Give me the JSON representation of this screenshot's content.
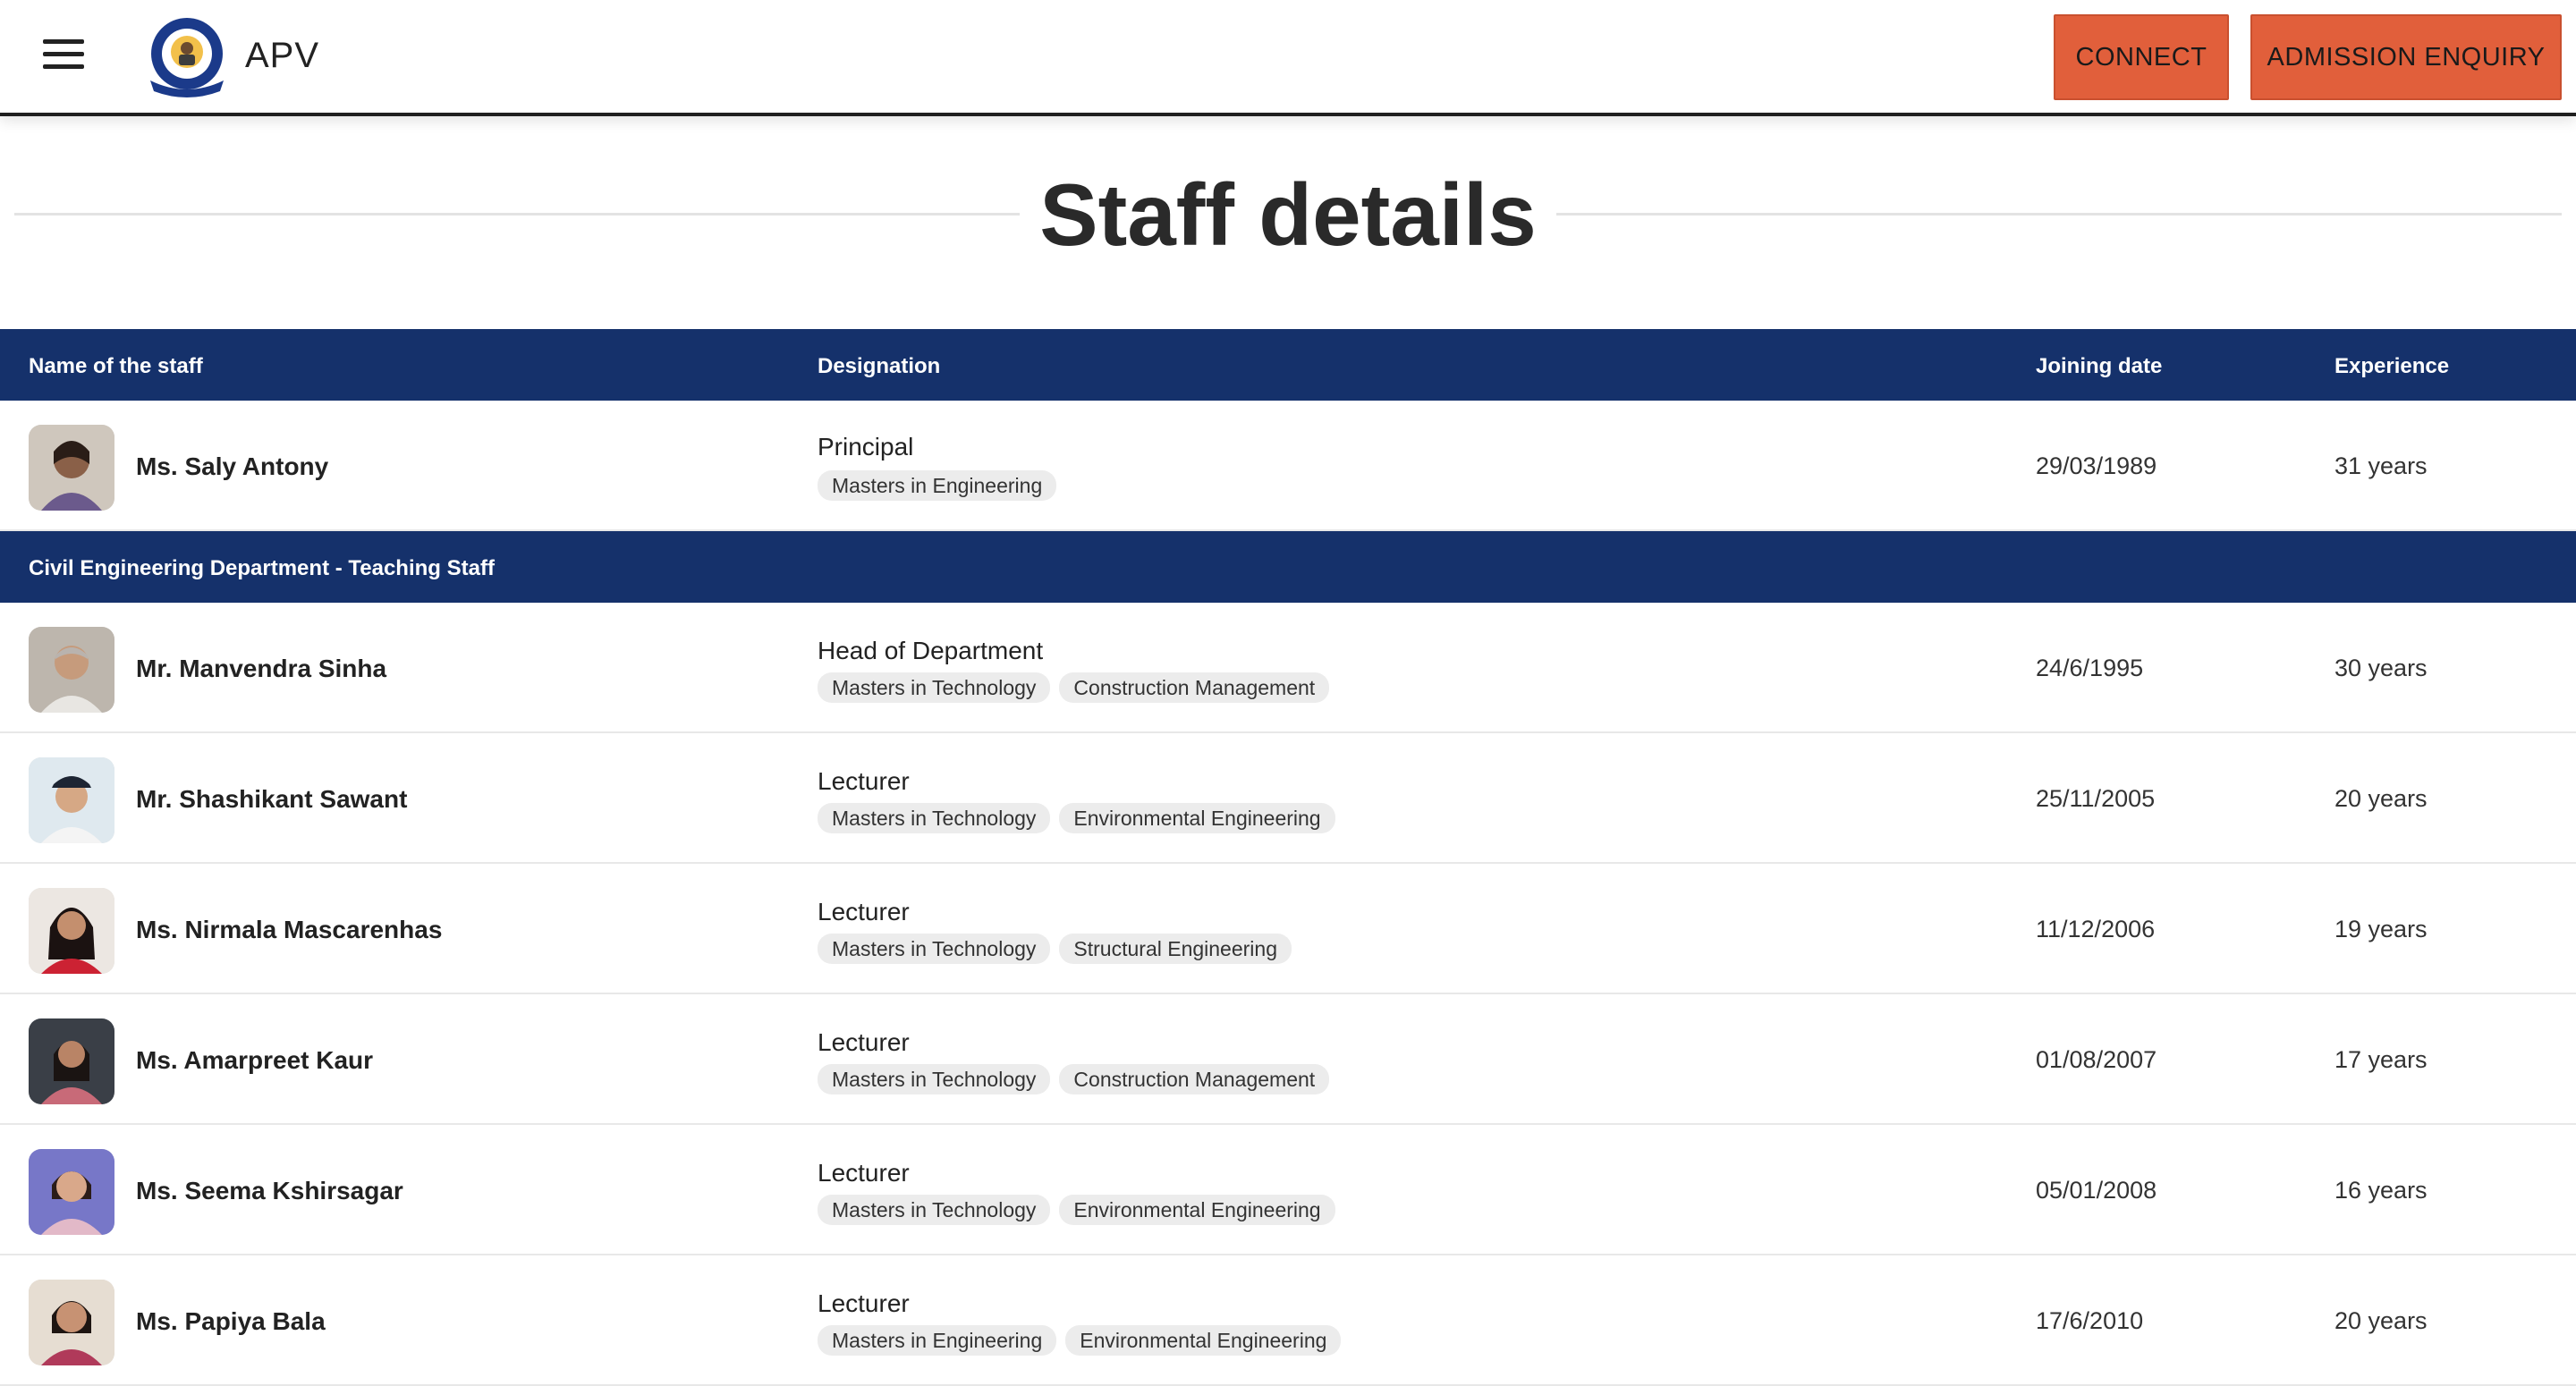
{
  "header": {
    "brand": "APV",
    "connect_label": "CONNECT",
    "enquiry_label": "ADMISSION ENQUIRY",
    "accent_color": "#e15f3b"
  },
  "page": {
    "title": "Staff details"
  },
  "table": {
    "header_color": "#15316b",
    "columns": [
      "Name of the staff",
      "Designation",
      "Joining date",
      "Experience"
    ],
    "principal": {
      "name": "Ms. Saly Antony",
      "designation": "Principal",
      "tags": [
        "Masters in Engineering"
      ],
      "joining_date": "29/03/1989",
      "experience": "31 years"
    },
    "section_label": "Civil Engineering Department - Teaching Staff",
    "rows": [
      {
        "name": "Mr. Manvendra Sinha",
        "designation": "Head of Department",
        "tags": [
          "Masters in Technology",
          "Construction Management"
        ],
        "joining_date": "24/6/1995",
        "experience": "30 years"
      },
      {
        "name": "Mr. Shashikant Sawant",
        "designation": "Lecturer",
        "tags": [
          "Masters in Technology",
          "Environmental Engineering"
        ],
        "joining_date": "25/11/2005",
        "experience": "20 years"
      },
      {
        "name": "Ms. Nirmala Mascarenhas",
        "designation": "Lecturer",
        "tags": [
          "Masters in Technology",
          "Structural Engineering"
        ],
        "joining_date": "11/12/2006",
        "experience": "19 years"
      },
      {
        "name": "Ms. Amarpreet Kaur",
        "designation": "Lecturer",
        "tags": [
          "Masters in Technology",
          "Construction Management"
        ],
        "joining_date": "01/08/2007",
        "experience": "17 years"
      },
      {
        "name": "Ms. Seema Kshirsagar",
        "designation": "Lecturer",
        "tags": [
          "Masters in Technology",
          "Environmental Engineering"
        ],
        "joining_date": "05/01/2008",
        "experience": "16 years"
      },
      {
        "name": "Ms. Papiya Bala",
        "designation": "Lecturer",
        "tags": [
          "Masters in Engineering",
          "Environmental Engineering"
        ],
        "joining_date": "17/6/2010",
        "experience": "20 years"
      }
    ]
  },
  "icons": {
    "menu": "hamburger-menu-icon",
    "logo": "college-crest-logo",
    "avatar": "staff-photo"
  }
}
